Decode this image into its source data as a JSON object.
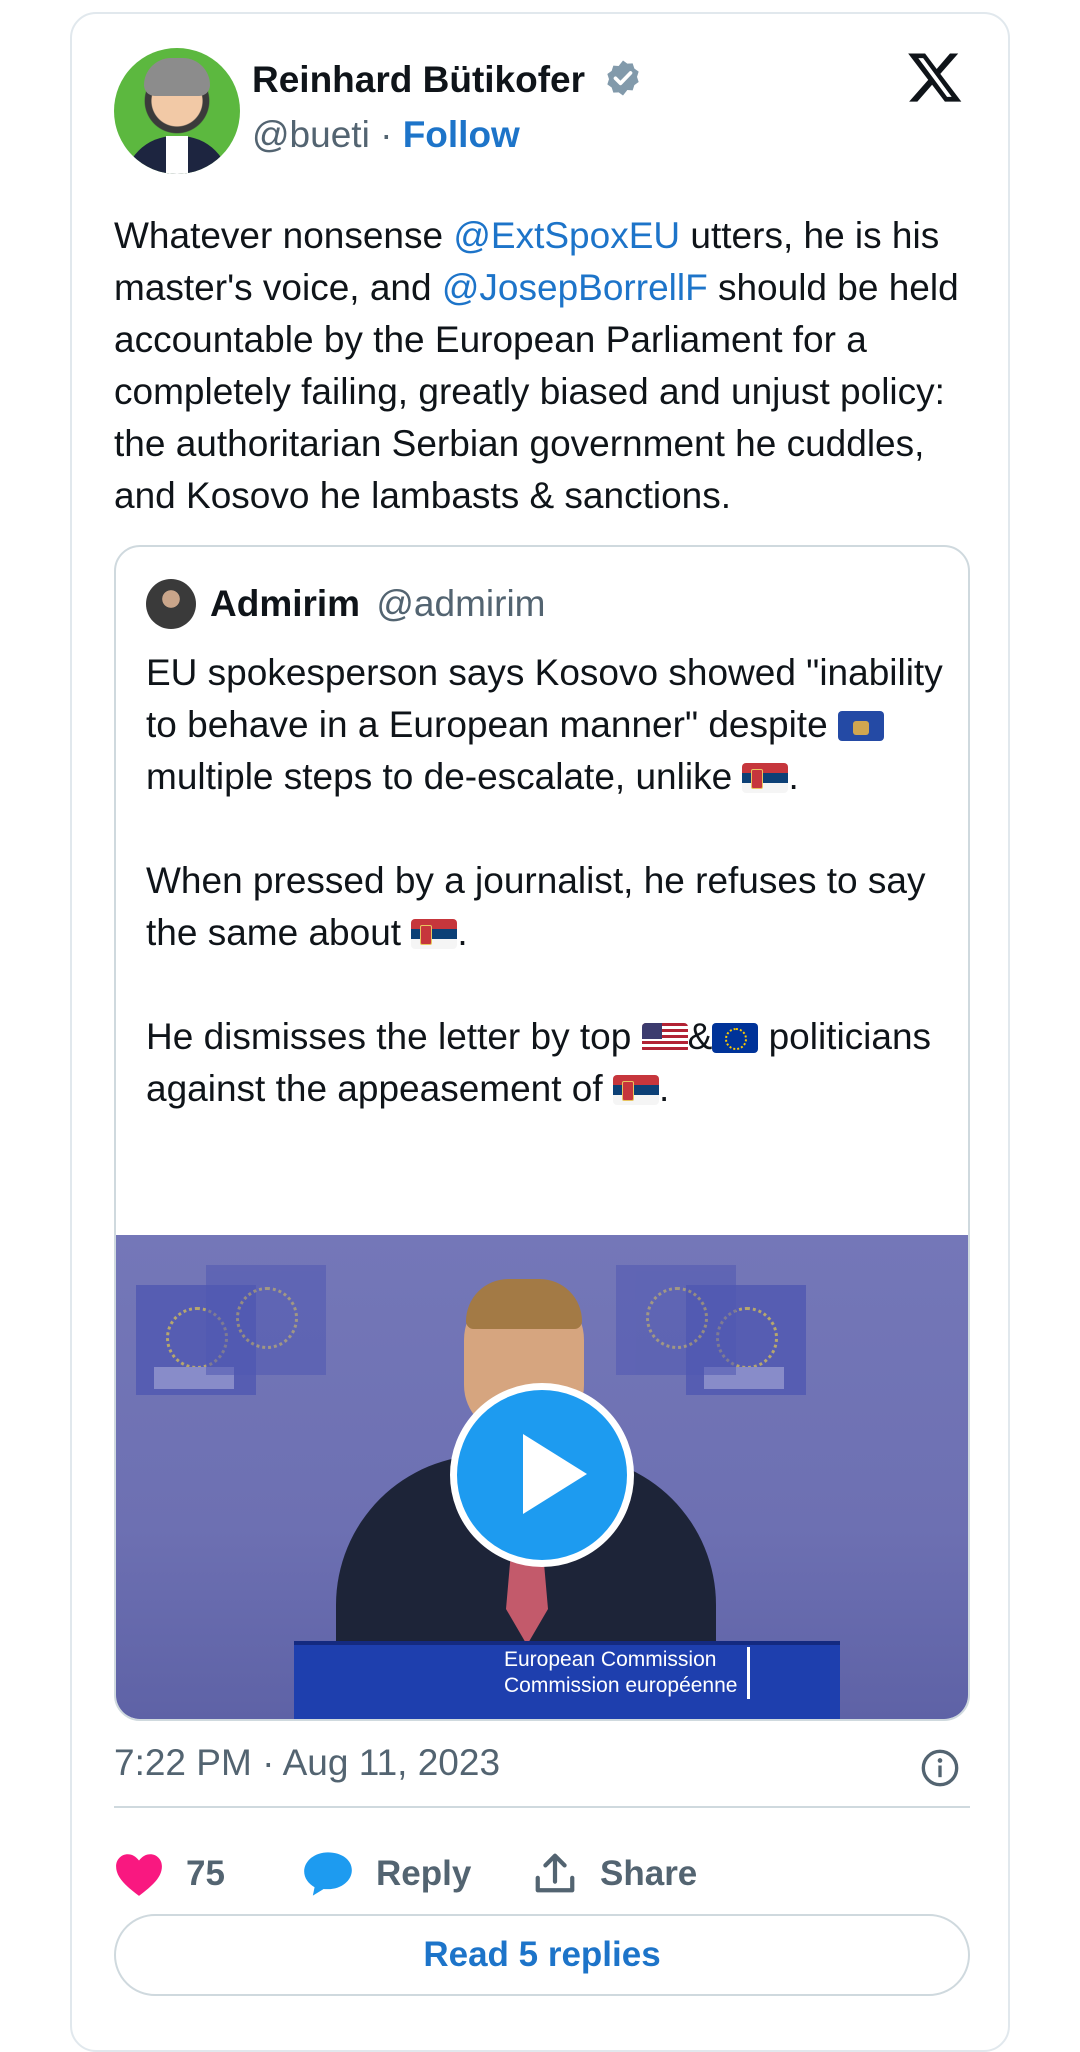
{
  "author": {
    "name": "Reinhard Bütikofer",
    "handle": "@bueti",
    "separator": "·",
    "follow_label": "Follow",
    "verified_icon": "verified-badge-icon"
  },
  "tweet": {
    "text_parts": [
      "Whatever nonsense ",
      "@ExtSpoxEU",
      " utters, he is his master's voice, and ",
      "@JosepBorrellF",
      " should be held accountable by the European Parliament for a completely failing, greatly biased and unjust policy: the authoritarian Serbian government he cuddles, and Kosovo he lambasts & sanctions."
    ]
  },
  "quote": {
    "name": "Admirim",
    "handle": "@admirim",
    "p1": {
      "a": "EU spokesperson says Kosovo showed \"inability to behave in a European manner\" despite ",
      "b": " multiple steps to de-escalate, unlike ",
      "c": "."
    },
    "p2": {
      "a": "When pressed by a journalist, he refuses to say the same about ",
      "b": "."
    },
    "p3": {
      "a": "He dismisses the letter by top ",
      "amp": "&",
      "b": " politicians against the appeasement of ",
      "c": "."
    },
    "flags": [
      "kosovo-flag",
      "serbia-flag",
      "usa-flag",
      "eu-flag"
    ],
    "video": {
      "podium_line1": "European Commission",
      "podium_line2": "Commission européenne",
      "play_icon": "play-icon"
    }
  },
  "meta": {
    "timestamp": "7:22 PM · Aug 11, 2023"
  },
  "actions": {
    "like_count": "75",
    "reply_label": "Reply",
    "share_label": "Share",
    "read_replies": "Read 5 replies"
  },
  "colors": {
    "link": "#1d74c9",
    "like": "#f91880",
    "reply_icon": "#1d9bf0",
    "muted": "#536471"
  }
}
